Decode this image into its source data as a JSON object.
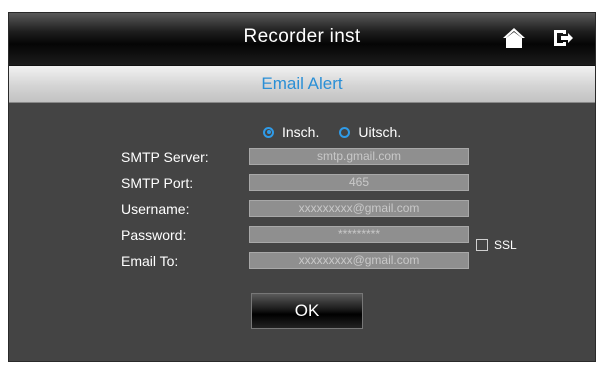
{
  "header": {
    "title": "Recorder inst",
    "icons": [
      "home-icon",
      "back-icon"
    ]
  },
  "subheader": {
    "title": "Email Alert"
  },
  "alert_toggle": {
    "options": [
      {
        "label": "Insch.",
        "selected": true
      },
      {
        "label": "Uitsch.",
        "selected": false
      }
    ]
  },
  "form": {
    "smtp_server": {
      "label": "SMTP Server:",
      "value": "smtp.gmail.com"
    },
    "smtp_port": {
      "label": "SMTP Port:",
      "value": "465"
    },
    "username": {
      "label": "Username:",
      "value": "xxxxxxxxx@gmail.com"
    },
    "password": {
      "label": "Password:",
      "value": "*********"
    },
    "email_to": {
      "label": "Email To:",
      "value": "xxxxxxxxx@gmail.com"
    },
    "ssl": {
      "label": "SSL",
      "checked": false
    }
  },
  "actions": {
    "ok_label": "OK"
  },
  "colors": {
    "accent": "#2f9be8",
    "subtitle": "#2a8fd6",
    "panel": "#444444"
  }
}
